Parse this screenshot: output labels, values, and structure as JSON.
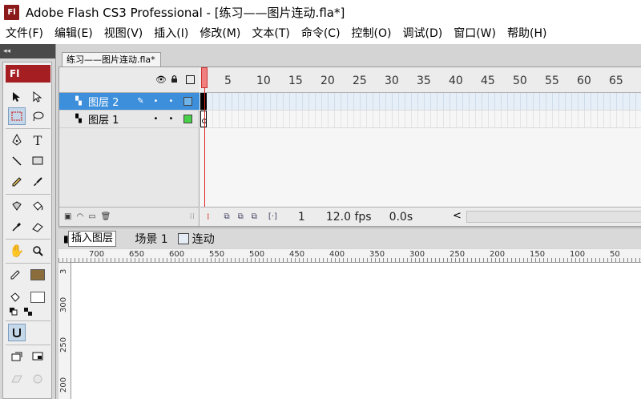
{
  "window": {
    "logo_text": "Fl",
    "title": "Adobe Flash CS3 Professional - [练习——图片连动.fla*]"
  },
  "menu": [
    "文件(F)",
    "编辑(E)",
    "视图(V)",
    "插入(I)",
    "修改(M)",
    "文本(T)",
    "命令(C)",
    "控制(O)",
    "调试(D)",
    "窗口(W)",
    "帮助(H)"
  ],
  "toolbox": {
    "collapse_glyph": "◂◂",
    "badge": "Fl",
    "tools": [
      "selection-tool",
      "subselection-tool",
      "free-transform-tool",
      "lasso-tool",
      "pen-tool",
      "text-tool",
      "line-tool",
      "rectangle-tool",
      "pencil-tool",
      "brush-tool",
      "ink-bottle-tool",
      "paint-bucket-tool",
      "eyedropper-tool",
      "eraser-tool",
      "hand-tool",
      "zoom-tool",
      "stroke-color",
      "fill-color",
      "black-white",
      "swap-colors",
      "snap-to-objects",
      "smooth",
      "straighten"
    ],
    "stroke_color": "#8a6d3b",
    "fill_color": "#ffffff"
  },
  "document": {
    "tab_label": "练习——图片连动.fla*"
  },
  "timeline": {
    "layers": [
      {
        "name": "图层 2",
        "selected": true,
        "outline_color": "#6fb3e8"
      },
      {
        "name": "图层 1",
        "selected": false,
        "outline_color": "#49d049"
      }
    ],
    "frame_numbers": [
      "5",
      "10",
      "15",
      "20",
      "25",
      "30",
      "35",
      "40",
      "45",
      "50",
      "55",
      "60",
      "65"
    ],
    "current_frame": "1",
    "fps": "12.0 fps",
    "elapsed": "0.0s",
    "scroll_left": "<"
  },
  "editbar": {
    "tooltip": "插入图层",
    "scene": "场景 1",
    "symbol": "连动"
  },
  "ruler": {
    "h_labels": [
      "700",
      "650",
      "600",
      "550",
      "500",
      "450",
      "400",
      "350",
      "300",
      "250",
      "200",
      "150",
      "100",
      "50"
    ],
    "v_labels": [
      "3",
      "300",
      "250",
      "200"
    ]
  }
}
